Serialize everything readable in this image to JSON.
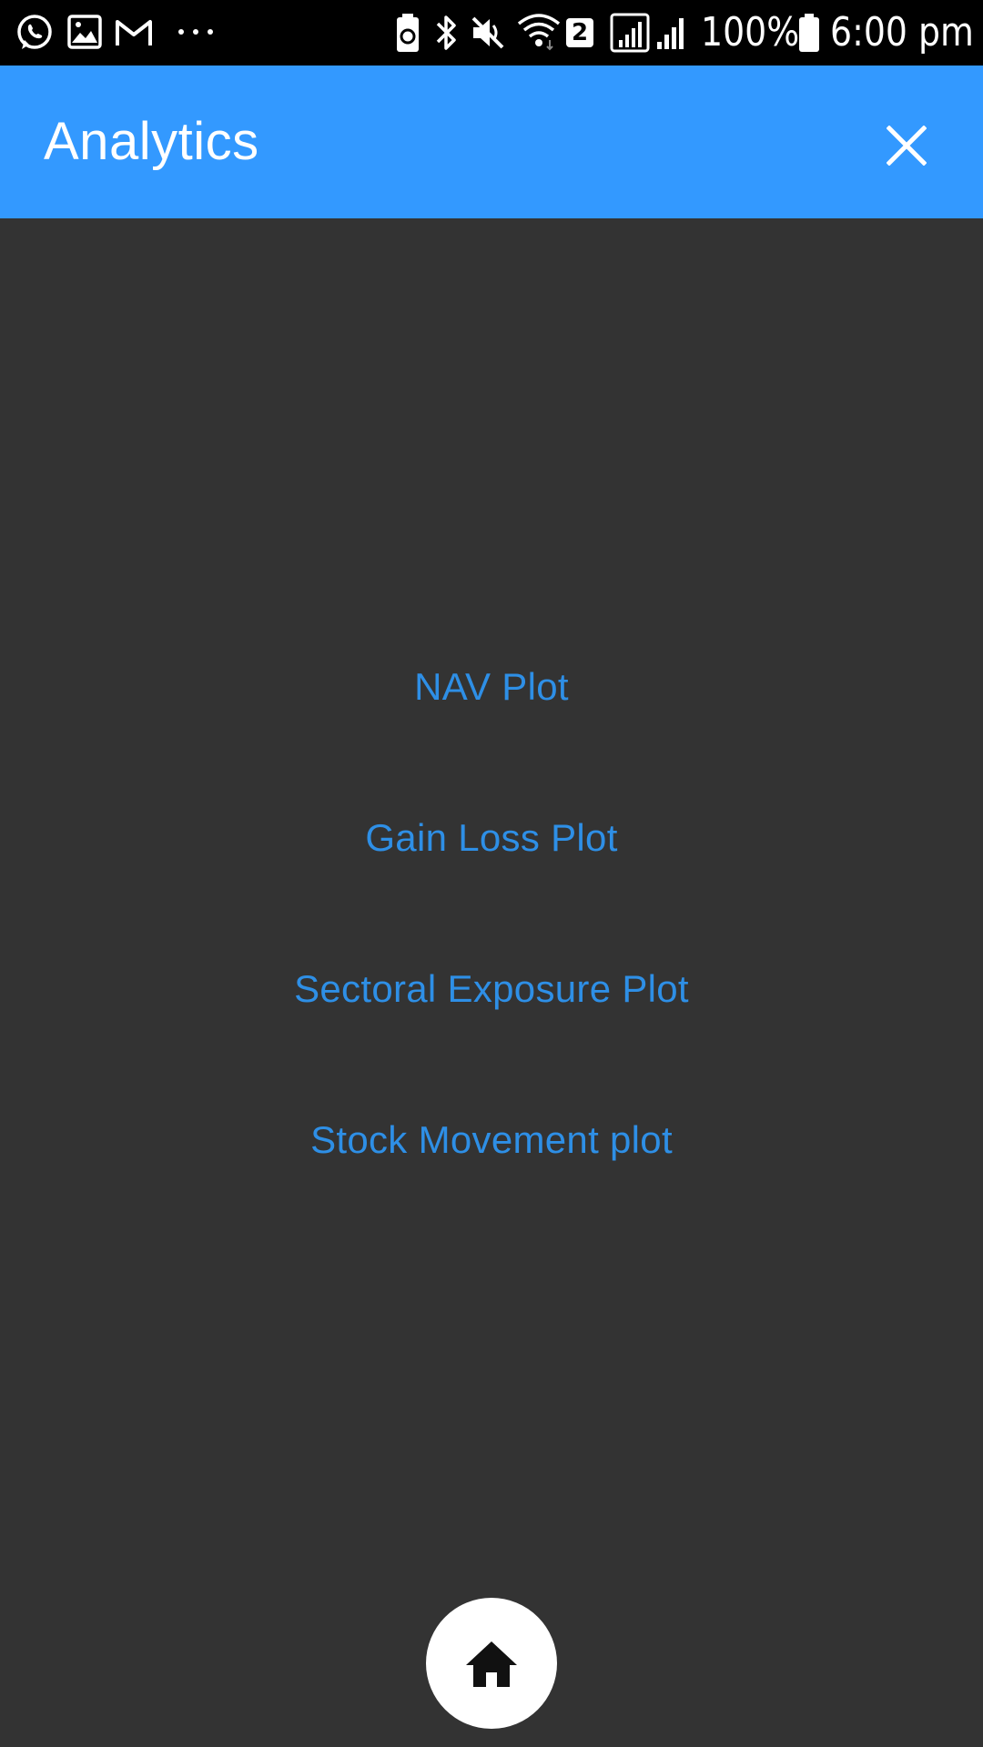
{
  "status_bar": {
    "notification_icons": [
      "whatsapp-icon",
      "gallery-icon",
      "gmail-icon",
      "more-notifications-icon"
    ],
    "system_icons": [
      "battery-saver-icon",
      "bluetooth-icon",
      "mute-icon",
      "wifi-icon",
      "sim-2-icon",
      "signal-icon",
      "signal-icon",
      "battery-icon"
    ],
    "sim_badge": "2",
    "battery_percent": "100%",
    "time": "6:00 pm"
  },
  "header": {
    "title": "Analytics",
    "close_icon": "close-icon",
    "background_color": "#3399ff"
  },
  "menu": {
    "items": [
      {
        "label": "NAV Plot"
      },
      {
        "label": "Gain Loss Plot"
      },
      {
        "label": "Sectoral Exposure Plot"
      },
      {
        "label": "Stock Movement plot"
      }
    ],
    "link_color": "#2e8fe6"
  },
  "home_button": {
    "icon": "home-icon"
  },
  "colors": {
    "page_background": "#333333",
    "status_bar": "#000000"
  }
}
